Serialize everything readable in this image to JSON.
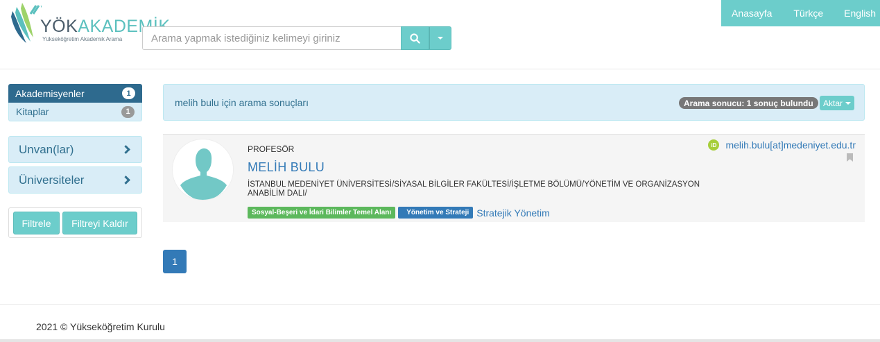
{
  "header": {
    "brand_yok": "YÖK",
    "brand_akademik": "AKADEMİK",
    "tagline": "Yükseköğretim Akademik Arama",
    "search_placeholder": "Arama yapmak istediğiniz kelimeyi giriniz",
    "search_icon": "search-icon",
    "nav": [
      "Anasayfa",
      "Türkçe",
      "English"
    ]
  },
  "sidebar": {
    "categories": [
      {
        "label": "Akademisyenler",
        "count": "1",
        "active": true
      },
      {
        "label": "Kitaplar",
        "count": "1",
        "active": false
      }
    ],
    "facets": [
      "Unvan(lar)",
      "Üniversiteler"
    ],
    "filter_button": "Filtrele",
    "clear_filter_button": "Filtreyi Kaldır"
  },
  "results": {
    "title": "melih bulu için arama sonuçları",
    "count_badge": "Arama sonucu: 1 sonuç bulundu",
    "export_label": "Aktar"
  },
  "card": {
    "rank": "PROFESÖR",
    "name": "MELİH BULU",
    "affiliation": "İSTANBUL MEDENİYET ÜNİVERSİTESİ/SİYASAL BİLGİLER FAKÜLTESİ/İŞLETME BÖLÜMÜ/YÖNETİM VE ORGANİZASYON ANABİLİM DALI/",
    "tags": [
      "Sosyal-Beşeri ve İdari Bilimler Temel Alanı",
      "Yönetim ve Strateji"
    ],
    "keyword": "Stratejik Yönetim",
    "orcid_label": "iD",
    "email": "melih.bulu[at]medeniyet.edu.tr"
  },
  "pagination": {
    "current": "1"
  },
  "footer": {
    "copyright": "2021 © Yükseköğretim Kurulu"
  },
  "colors": {
    "accent": "#6ccdcb",
    "primary": "#337ab7",
    "dark": "#2e6a8e",
    "info_bg": "#d9edf7"
  }
}
